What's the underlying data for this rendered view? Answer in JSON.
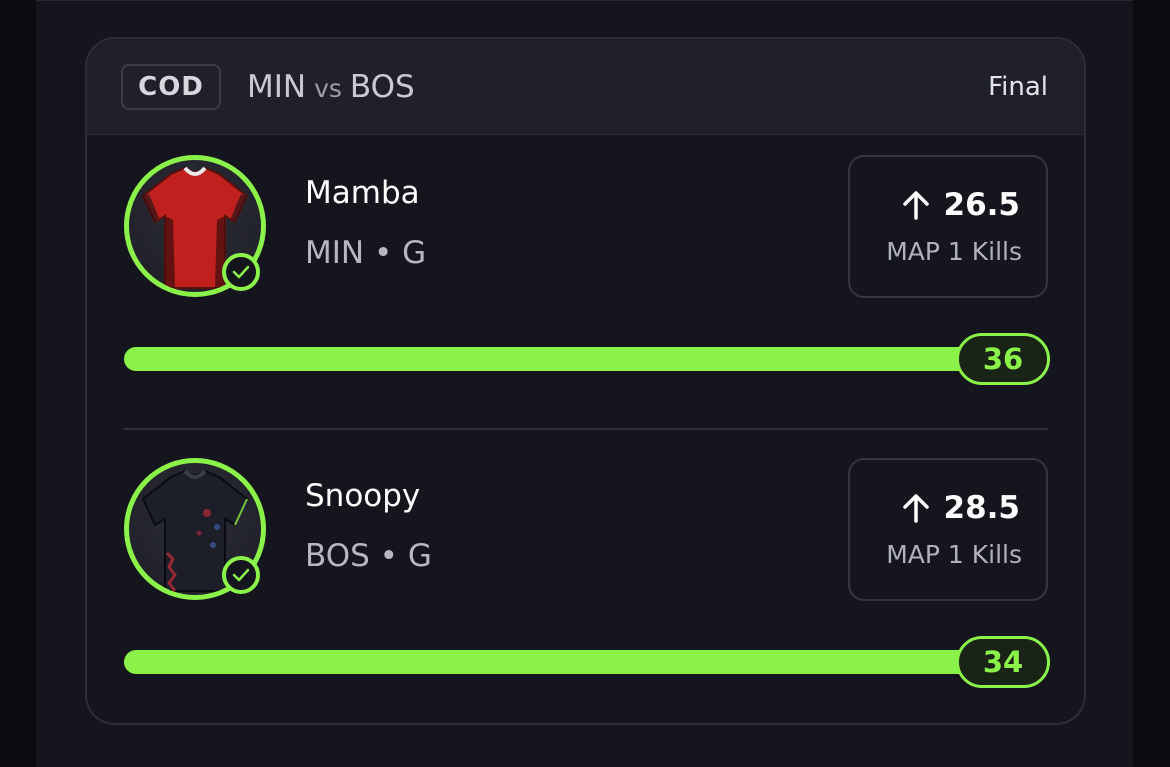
{
  "header": {
    "league": "COD",
    "team_a": "MIN",
    "vs": "vs",
    "team_b": "BOS",
    "status": "Final"
  },
  "players": [
    {
      "name": "Mamba",
      "team": "MIN",
      "separator": "•",
      "position": "G",
      "line": "26.5",
      "direction": "up",
      "stat": "MAP 1 Kills",
      "result": "36",
      "progress_fraction": 1.0,
      "jersey_color": "#c0211f",
      "jersey_accent": "#3a0d0c",
      "verified": true
    },
    {
      "name": "Snoopy",
      "team": "BOS",
      "separator": "•",
      "position": "G",
      "line": "28.5",
      "direction": "up",
      "stat": "MAP 1 Kills",
      "result": "34",
      "progress_fraction": 1.0,
      "jersey_color": "#1c1f27",
      "jersey_accent": "#b8293b",
      "verified": true
    }
  ],
  "colors": {
    "accent": "#8bf24a",
    "background": "#14151d",
    "header": "#1f2029"
  },
  "icons": {
    "direction": "arrow-up-icon",
    "verified": "check-circle-icon"
  }
}
